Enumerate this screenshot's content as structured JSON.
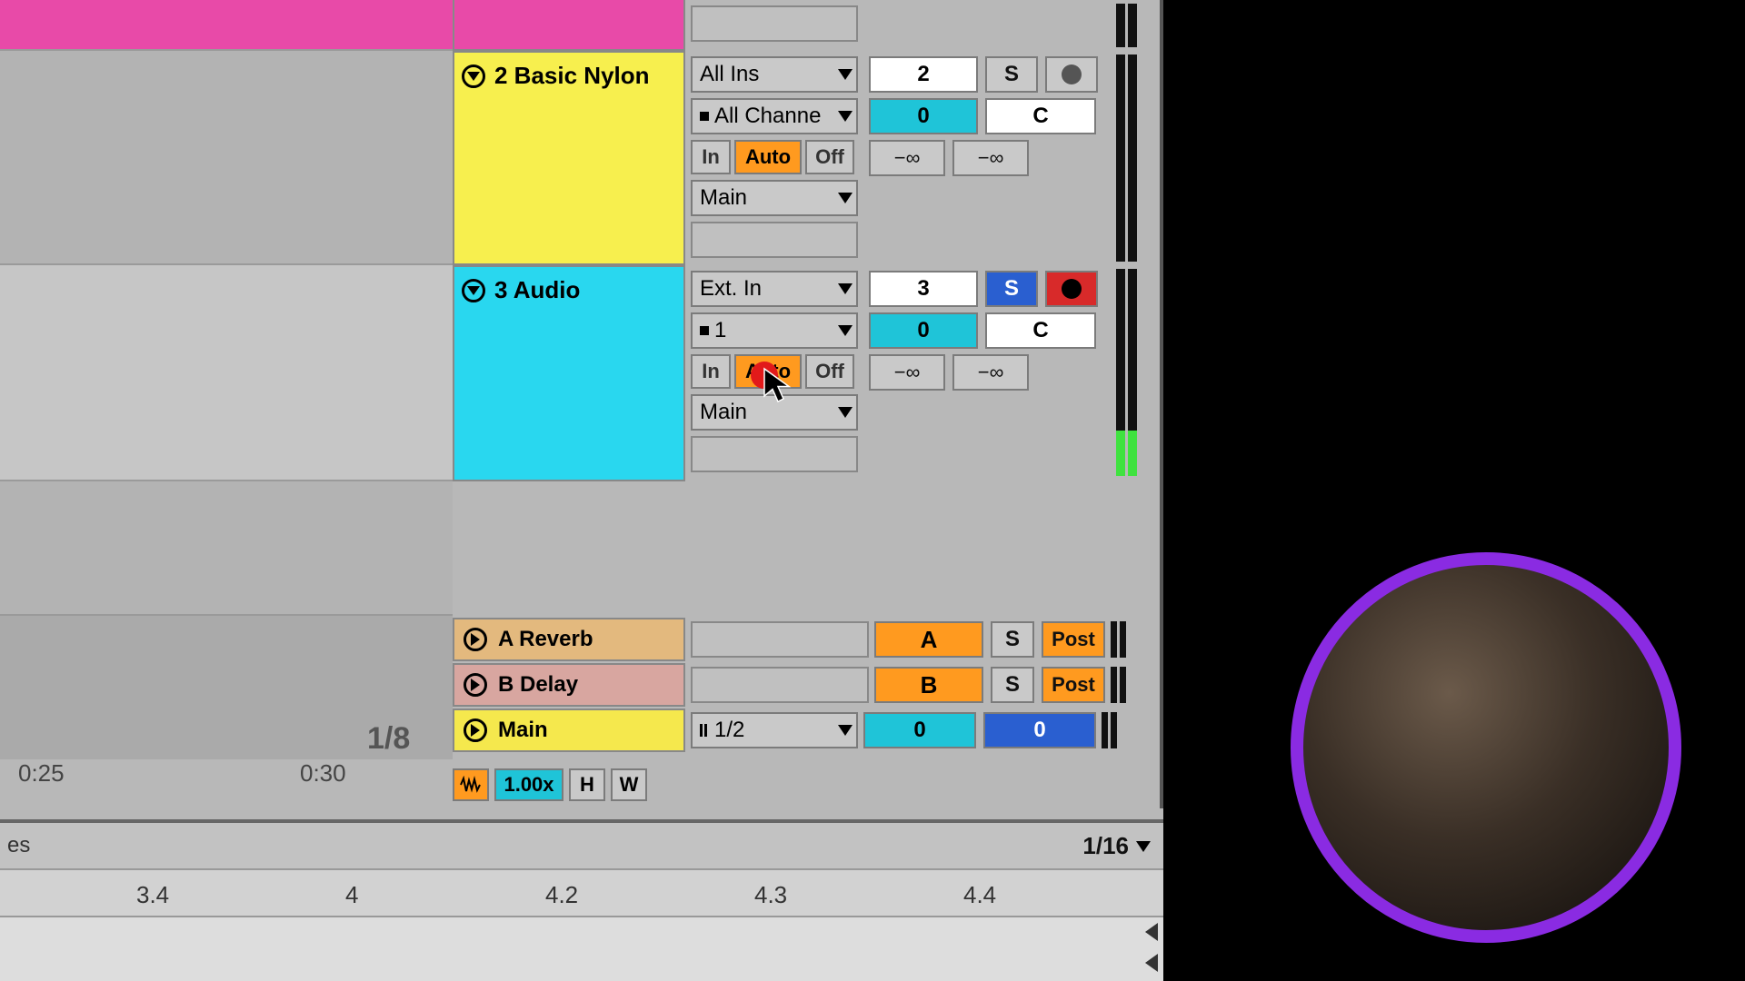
{
  "tracks": {
    "t1": {
      "color": "#e84aa8"
    },
    "t2": {
      "name": "2 Basic Nylon",
      "color": "#f7ef4e",
      "input_type": "All Ins",
      "input_ch": "All Channe",
      "mon_in": "In",
      "mon_auto": "Auto",
      "mon_off": "Off",
      "output": "Main",
      "num": "2",
      "solo": "S",
      "pan": "0",
      "panL": "C",
      "sendA": "−∞",
      "sendB": "−∞"
    },
    "t3": {
      "name": "3 Audio",
      "color": "#29d7ef",
      "input_type": "Ext. In",
      "input_ch": "1",
      "mon_in": "In",
      "mon_auto": "Auto",
      "mon_off": "Off",
      "output": "Main",
      "num": "3",
      "solo": "S",
      "pan": "0",
      "panL": "C",
      "sendA": "−∞",
      "sendB": "−∞"
    }
  },
  "returns": {
    "a": {
      "name": "A Reverb",
      "send": "A",
      "solo": "S",
      "post": "Post",
      "color": "#e3b97e"
    },
    "b": {
      "name": "B Delay",
      "send": "B",
      "solo": "S",
      "post": "Post",
      "color": "#d8a6a0"
    },
    "main": {
      "name": "Main",
      "out": "1/2",
      "vol": "0",
      "cue": "0",
      "color": "#f5e84d"
    }
  },
  "transport": {
    "quant": "1/8",
    "groove_amt": "1.00x",
    "h": "H",
    "w": "W",
    "time_a": "0:25",
    "time_b": "0:30"
  },
  "clip_editor": {
    "tab": "es",
    "grid": "1/16",
    "marks": {
      "a": "3.4",
      "b": "4",
      "c": "4.2",
      "d": "4.3",
      "e": "4.4"
    }
  }
}
